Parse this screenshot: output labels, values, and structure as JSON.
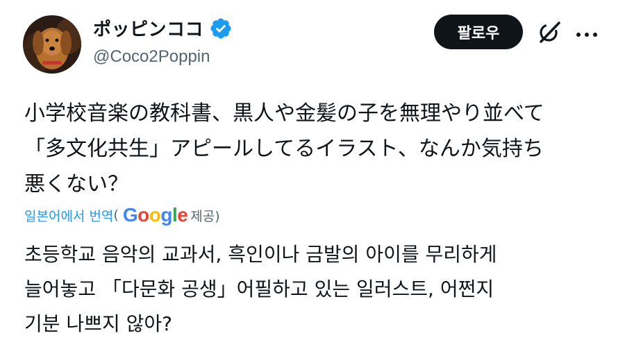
{
  "author": {
    "display_name": "ポッピンココ",
    "handle": "@Coco2Poppin",
    "verified": true
  },
  "actions": {
    "follow_label": "팔로우",
    "grok_icon": "grok-icon",
    "more_icon": "more-dots-icon"
  },
  "tweet": {
    "text": "小学校音楽の教科書、黒人や金髪の子を無理やり並べて\n「多文化共生」アピールしてるイラスト、なんか気持ち\n悪くない？"
  },
  "translation": {
    "label": "일본어에서 번역",
    "open_paren": "(",
    "provider": "Google",
    "provided_label": "제공)",
    "text": "초등학교 음악의 교과서, 흑인이나 금발의 아이를 무리하게\n늘어놓고 「다문화 공생」어필하고 있는 일러스트, 어쩐지\n기분 나쁘지 않아?"
  },
  "colors": {
    "verified_blue": "#1d9bf0",
    "text": "#0f1419",
    "secondary": "#536471"
  }
}
